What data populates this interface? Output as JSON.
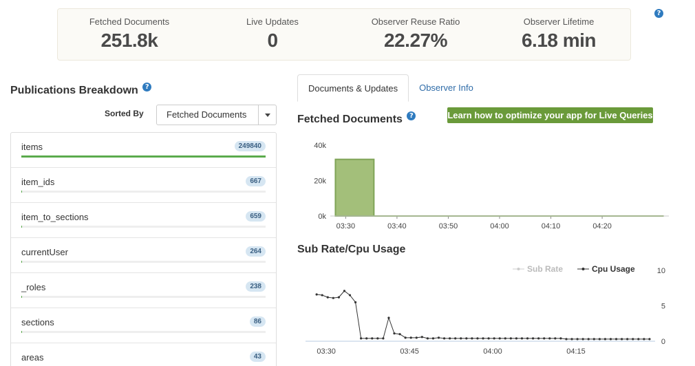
{
  "stats": [
    {
      "label": "Fetched Documents",
      "value": "251.8k"
    },
    {
      "label": "Live Updates",
      "value": "0"
    },
    {
      "label": "Observer Reuse Ratio",
      "value": "22.27%"
    },
    {
      "label": "Observer Lifetime",
      "value": "6.18 min"
    }
  ],
  "help_glyph": "?",
  "publications": {
    "title": "Publications Breakdown",
    "sorted_by_label": "Sorted By",
    "sort_selected": "Fetched Documents",
    "items": [
      {
        "name": "items",
        "count": "249840",
        "fraction": 1.0
      },
      {
        "name": "item_ids",
        "count": "667",
        "fraction": 0.003
      },
      {
        "name": "item_to_sections",
        "count": "659",
        "fraction": 0.003
      },
      {
        "name": "currentUser",
        "count": "264",
        "fraction": 0.001
      },
      {
        "name": "_roles",
        "count": "238",
        "fraction": 0.001
      },
      {
        "name": "sections",
        "count": "86",
        "fraction": 0.0
      },
      {
        "name": "areas",
        "count": "43",
        "fraction": 0.0
      }
    ]
  },
  "tabs": [
    {
      "label": "Documents & Updates",
      "active": true
    },
    {
      "label": "Observer Info",
      "active": false
    }
  ],
  "fetched_chart": {
    "title": "Fetched Documents",
    "learn_button": "Learn how to optimize your app for Live Queries"
  },
  "sub_chart": {
    "title": "Sub Rate/Cpu Usage"
  },
  "colors": {
    "accent_green": "#6a9a3a",
    "bar_fill": "#a3bf7a",
    "link_blue": "#2f6ca8",
    "help_blue": "#2f7bbf"
  },
  "chart_data": [
    {
      "type": "area",
      "title": "Fetched Documents",
      "x_ticks": [
        "03:30",
        "03:40",
        "03:50",
        "04:00",
        "04:10",
        "04:20"
      ],
      "y_ticks": [
        "0k",
        "20k",
        "40k"
      ],
      "ylim": [
        0,
        40000
      ],
      "x_minutes": [
        0,
        10,
        20,
        30,
        40,
        50
      ],
      "series": [
        {
          "x_start": -2,
          "x_end": 62,
          "points": [
            [
              -2,
              32000
            ],
            [
              5.5,
              32000
            ],
            [
              5.5,
              0
            ],
            [
              62,
              0
            ]
          ]
        }
      ],
      "x_range": [
        -3,
        63
      ]
    },
    {
      "type": "line",
      "title": "Sub Rate/Cpu Usage",
      "x_ticks": [
        "03:30",
        "03:45",
        "04:00",
        "04:15"
      ],
      "x_tick_minutes": [
        0,
        15,
        30,
        45
      ],
      "y_ticks": [
        "0",
        "5",
        "10"
      ],
      "ylim": [
        0,
        10
      ],
      "x_range": [
        -2,
        61
      ],
      "legend": [
        "Sub Rate",
        "Cpu Usage"
      ],
      "series": [
        {
          "name": "Sub Rate",
          "values": []
        },
        {
          "name": "Cpu Usage",
          "x": [
            0,
            1,
            2,
            3,
            4,
            5,
            6,
            7,
            8,
            9,
            10,
            11,
            12,
            13,
            14,
            15,
            16,
            17,
            18,
            19,
            20,
            21,
            22,
            23,
            24,
            25,
            26,
            27,
            28,
            29,
            30,
            31,
            32,
            33,
            34,
            35,
            36,
            37,
            38,
            39,
            40,
            41,
            42,
            43,
            44,
            45,
            46,
            47,
            48,
            49,
            50,
            51,
            52,
            53,
            54,
            55,
            56,
            57,
            58,
            59,
            60
          ],
          "values": [
            6.6,
            6.5,
            6.2,
            6.1,
            6.2,
            7.1,
            6.5,
            5.5,
            0.4,
            0.4,
            0.4,
            0.4,
            0.4,
            3.3,
            1.1,
            1.0,
            0.5,
            0.5,
            0.5,
            0.6,
            0.4,
            0.4,
            0.5,
            0.4,
            0.4,
            0.4,
            0.4,
            0.4,
            0.4,
            0.4,
            0.4,
            0.4,
            0.4,
            0.4,
            0.4,
            0.4,
            0.4,
            0.4,
            0.4,
            0.4,
            0.4,
            0.4,
            0.4,
            0.4,
            0.4,
            0.3,
            0.3,
            0.3,
            0.3,
            0.3,
            0.3,
            0.3,
            0.3,
            0.3,
            0.3,
            0.3,
            0.3,
            0.3,
            0.3,
            0.3,
            0.3
          ]
        }
      ]
    }
  ]
}
